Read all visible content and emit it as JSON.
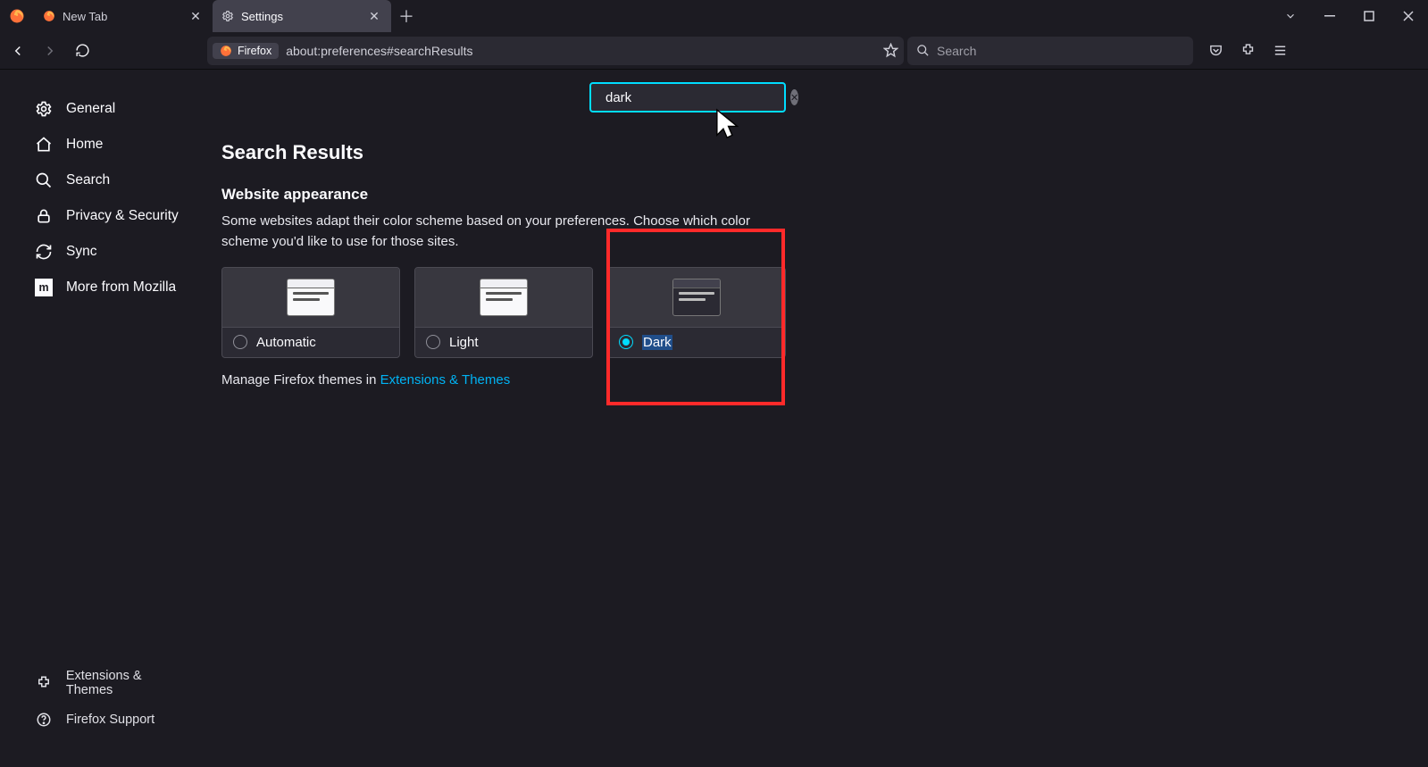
{
  "tabs": {
    "t0": {
      "title": "New Tab"
    },
    "t1": {
      "title": "Settings"
    }
  },
  "navbar": {
    "identity_label": "Firefox",
    "url": "about:preferences#searchResults",
    "search_placeholder": "Search"
  },
  "sidebar": {
    "items": [
      {
        "label": "General"
      },
      {
        "label": "Home"
      },
      {
        "label": "Search"
      },
      {
        "label": "Privacy & Security"
      },
      {
        "label": "Sync"
      },
      {
        "label": "More from Mozilla"
      }
    ],
    "bottom": [
      {
        "label": "Extensions & Themes"
      },
      {
        "label": "Firefox Support"
      }
    ]
  },
  "settings_search": {
    "value": "dark"
  },
  "content": {
    "title": "Search Results",
    "section_title": "Website appearance",
    "section_desc": "Some websites adapt their color scheme based on your preferences. Choose which color scheme you'd like to use for those sites.",
    "options": {
      "automatic": "Automatic",
      "light": "Light",
      "dark": "Dark"
    },
    "manage_prefix": "Manage Firefox themes in ",
    "manage_link": "Extensions & Themes"
  }
}
